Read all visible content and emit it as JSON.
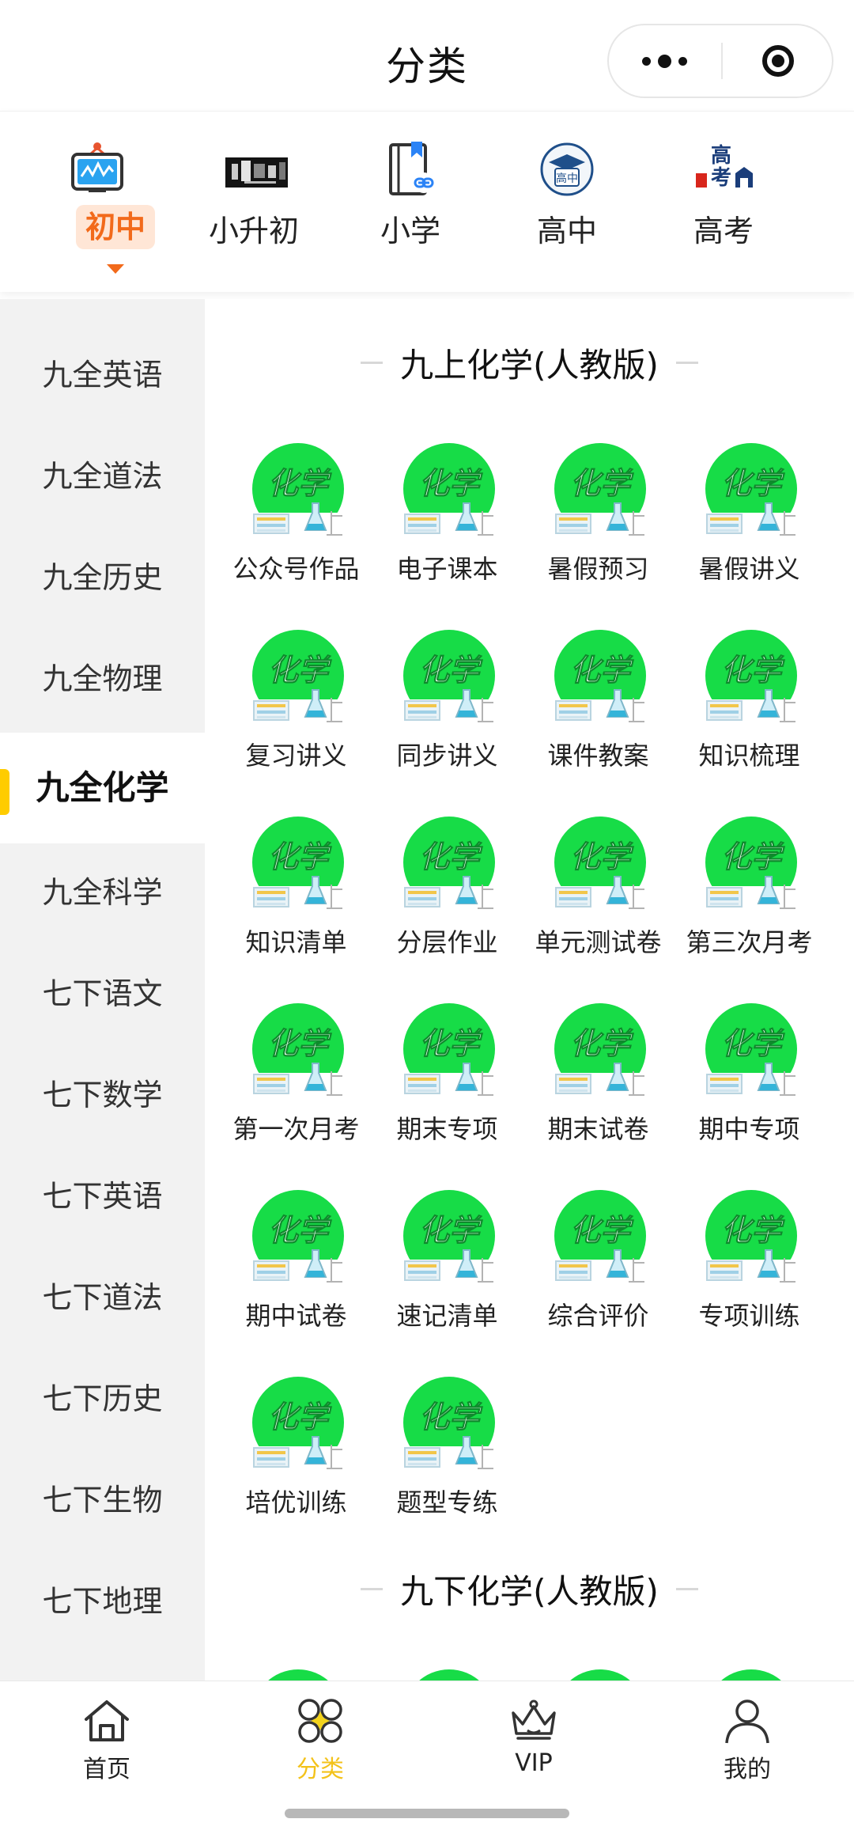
{
  "header": {
    "title": "分类"
  },
  "levels": [
    {
      "label": "初中",
      "icon": "monitor-icon",
      "active": true
    },
    {
      "label": "小升初",
      "icon": "banner-thumbnail-icon",
      "active": false
    },
    {
      "label": "小学",
      "icon": "book-link-icon",
      "active": false
    },
    {
      "label": "高中",
      "icon": "graduation-cap-icon",
      "active": false
    },
    {
      "label": "高考",
      "icon": "gaokao-icon",
      "active": false
    }
  ],
  "sidebar": {
    "items": [
      {
        "label": "九全英语"
      },
      {
        "label": "九全道法"
      },
      {
        "label": "九全历史"
      },
      {
        "label": "九全物理"
      },
      {
        "label": "九全化学",
        "active": true
      },
      {
        "label": "九全科学"
      },
      {
        "label": "七下语文"
      },
      {
        "label": "七下数学"
      },
      {
        "label": "七下英语"
      },
      {
        "label": "七下道法"
      },
      {
        "label": "七下历史"
      },
      {
        "label": "七下生物"
      },
      {
        "label": "七下地理"
      }
    ]
  },
  "main": {
    "icon_text": "化学",
    "sections": [
      {
        "title": "九上化学(人教版)",
        "items": [
          {
            "label": "公众号作品"
          },
          {
            "label": "电子课本"
          },
          {
            "label": "暑假预习"
          },
          {
            "label": "暑假讲义"
          },
          {
            "label": "复习讲义"
          },
          {
            "label": "同步讲义"
          },
          {
            "label": "课件教案"
          },
          {
            "label": "知识梳理"
          },
          {
            "label": "知识清单"
          },
          {
            "label": "分层作业"
          },
          {
            "label": "单元测试卷"
          },
          {
            "label": "第三次月考"
          },
          {
            "label": "第一次月考"
          },
          {
            "label": "期末专项"
          },
          {
            "label": "期末试卷"
          },
          {
            "label": "期中专项"
          },
          {
            "label": "期中试卷"
          },
          {
            "label": "速记清单"
          },
          {
            "label": "综合评价"
          },
          {
            "label": "专项训练"
          },
          {
            "label": "培优训练"
          },
          {
            "label": "题型专练"
          }
        ]
      },
      {
        "title": "九下化学(人教版)",
        "items": []
      }
    ]
  },
  "bottom_nav": [
    {
      "label": "首页",
      "icon": "home-icon",
      "active": false
    },
    {
      "label": "分类",
      "icon": "category-icon",
      "active": true
    },
    {
      "label": "VIP",
      "icon": "crown-icon",
      "active": false
    },
    {
      "label": "我的",
      "icon": "user-icon",
      "active": false
    }
  ],
  "colors": {
    "accent_orange": "#f26a1b",
    "accent_yellow": "#f3c21a",
    "icon_green": "#19d64a",
    "sidebar_bg": "#f2f2f2"
  }
}
